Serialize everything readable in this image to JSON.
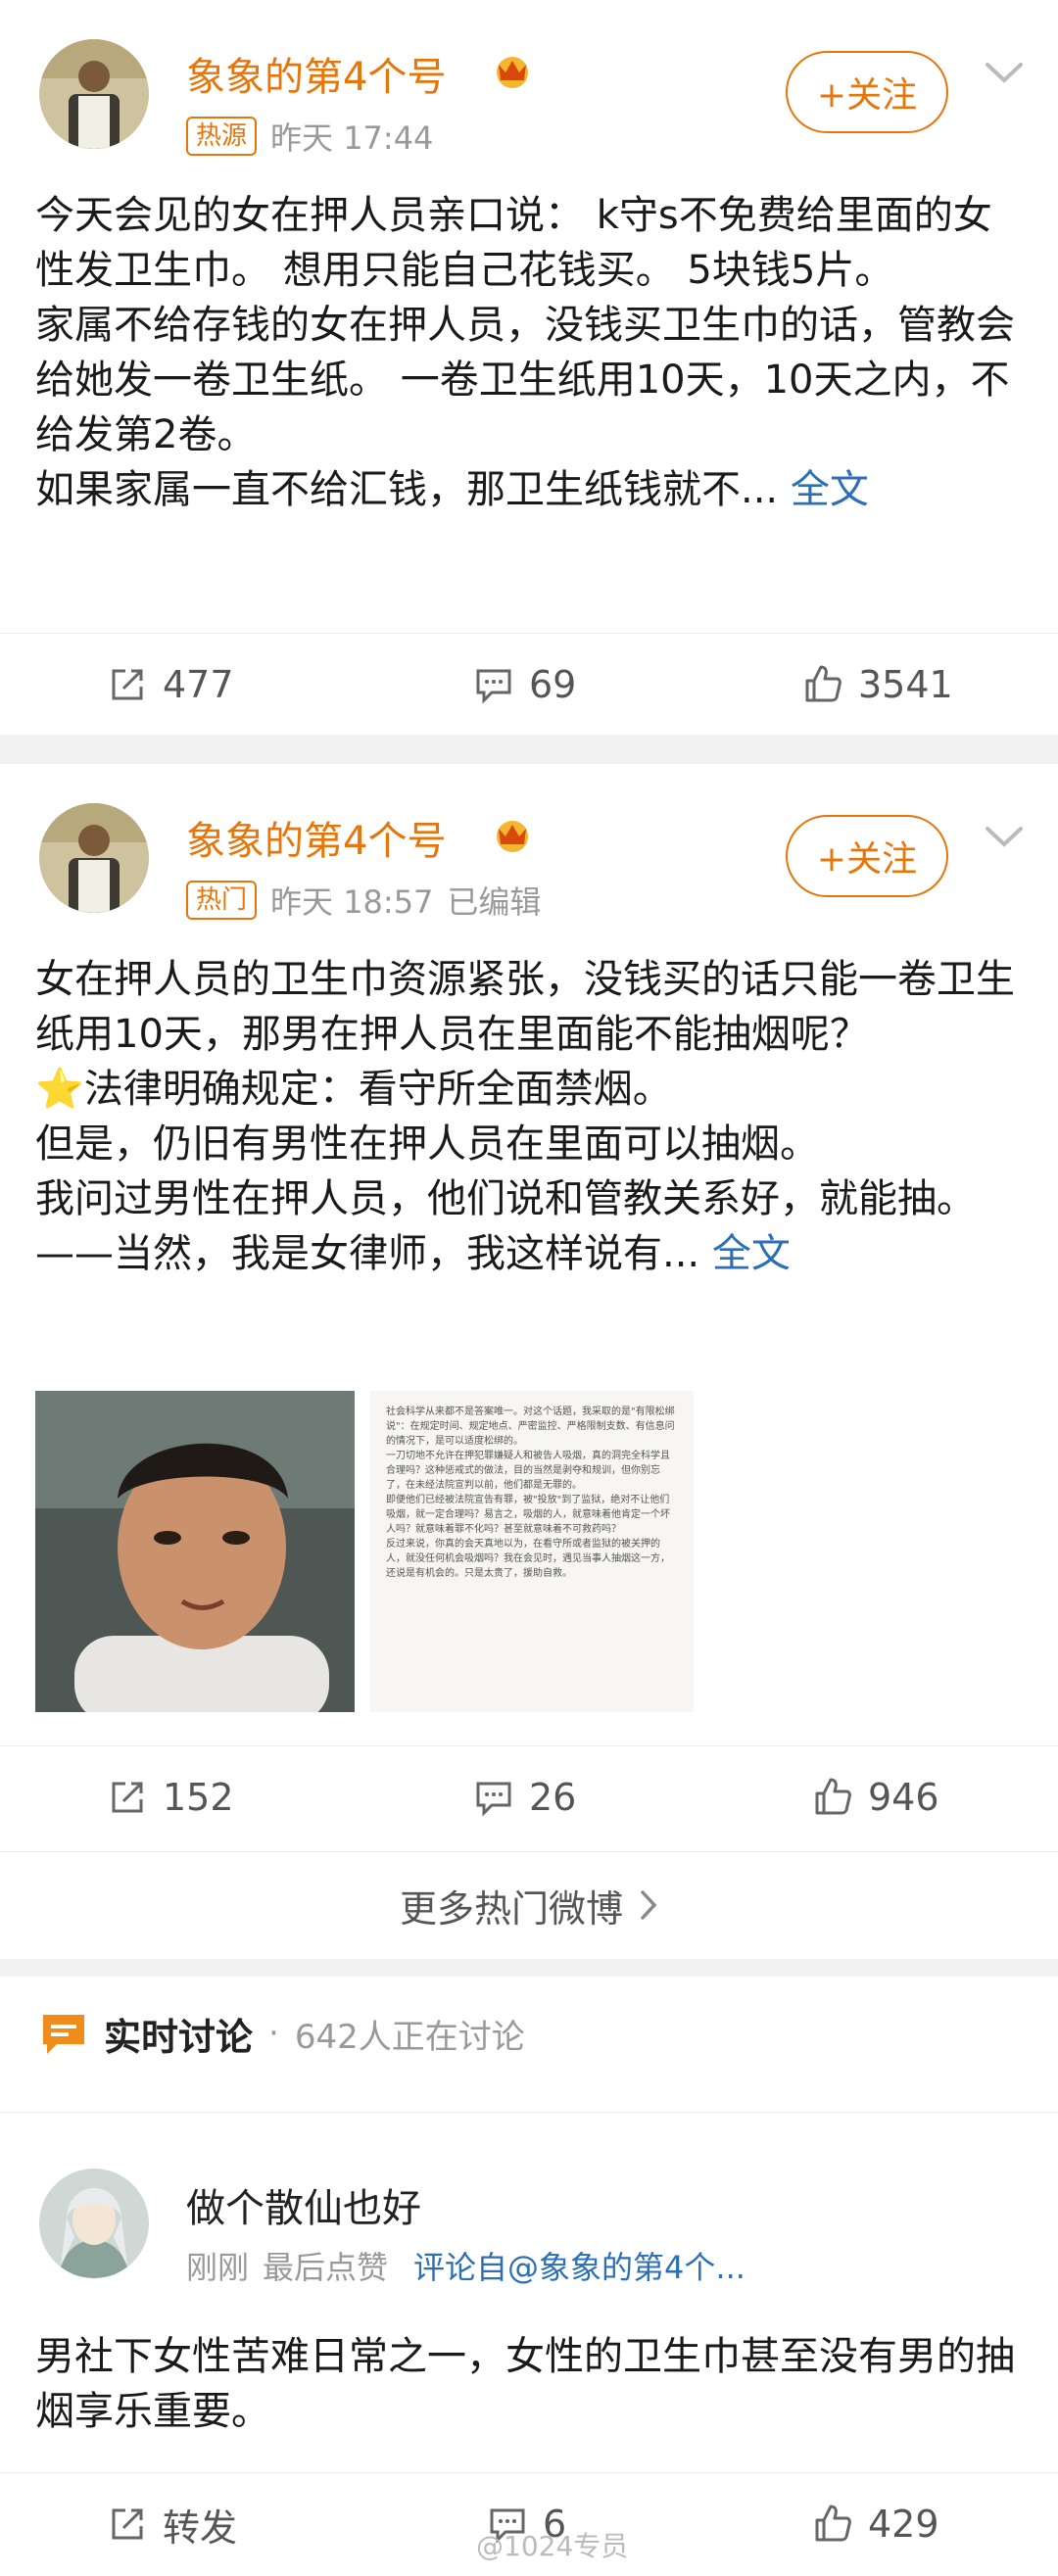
{
  "post1": {
    "username": "象象的第4个号",
    "badge": "热源",
    "time": "昨天 17:44",
    "follow": "+关注",
    "text": "今天会见的女在押人员亲口说： k守s不免费给里面的女性发卫生巾。 想用只能自己花钱买。 5块钱5片。\n家属不给存钱的女在押人员，没钱买卫生巾的话，管教会给她发一卷卫生纸。 一卷卫生纸用10天，10天之内，不给发第2卷。\n如果家属一直不给汇钱，那卫生纸钱就不... ",
    "fulltext": "全文",
    "repost": "477",
    "comment": "69",
    "like": "3541"
  },
  "post2": {
    "username": "象象的第4个号",
    "badge": "热门",
    "time": "昨天 18:57",
    "edited": "已编辑",
    "follow": "+关注",
    "text": "女在押人员的卫生巾资源紧张，没钱买的话只能一卷卫生纸用10天，那男在押人员在里面能不能抽烟呢？\n⭐法律明确规定：看守所全面禁烟。\n但是，仍旧有男性在押人员在里面可以抽烟。\n我问过男性在押人员，他们说和管教关系好，就能抽。——当然，我是女律师，我这样说有... ",
    "fulltext": "全文",
    "doc_text": "社会科学从来都不是答案唯一。对这个话题，我采取的是\"有限松绑说\"：在规定时间、规定地点、严密监控、严格限制支数、有信息问的情况下，是可以适度松绑的。\n一刀切地不允许在押犯罪嫌疑人和被告人吸烟，真的洞完全科学且合理吗？这种惩戒式的做法，目的当然是剥夺和规训，但你别忘了，在未经法院宣判以前，他们都是无罪的。\n即便他们已经被法院宣告有罪，被\"投放\"到了监狱，绝对不让他们吸烟，就一定合理吗？易言之，吸烟的人，就意味着他肯定一个坏人吗？就意味着罪不化吗？甚至就意味着不可救药吗？\n反过来说，你真的会天真地以为，在看守所或者监狱的被关押的人，就没任何机会吸烟吗？我在会见时，遇见当事人抽烟这一方，还说是有机会的。只是太贵了，援助自救。",
    "repost": "152",
    "comment": "26",
    "like": "946"
  },
  "more_link": "更多热门微博",
  "discussion": {
    "title": "实时讨论",
    "separator": "·",
    "count": "642人正在讨论"
  },
  "comment_item": {
    "username": "做个散仙也好",
    "time": "刚刚",
    "last_like": "最后点赞",
    "source": "评论自@象象的第4个...",
    "text": "男社下女性苦难日常之一，女性的卫生巾甚至没有男的抽烟享乐重要。",
    "repost": "转发",
    "comment": "6",
    "like": "429"
  },
  "watermark": "@1024专员",
  "colors": {
    "accent": "#e8750a",
    "link": "#2c6fb5",
    "page_bg": "#f2f2f2",
    "text": "#1a1a1a",
    "muted": "#999999"
  }
}
